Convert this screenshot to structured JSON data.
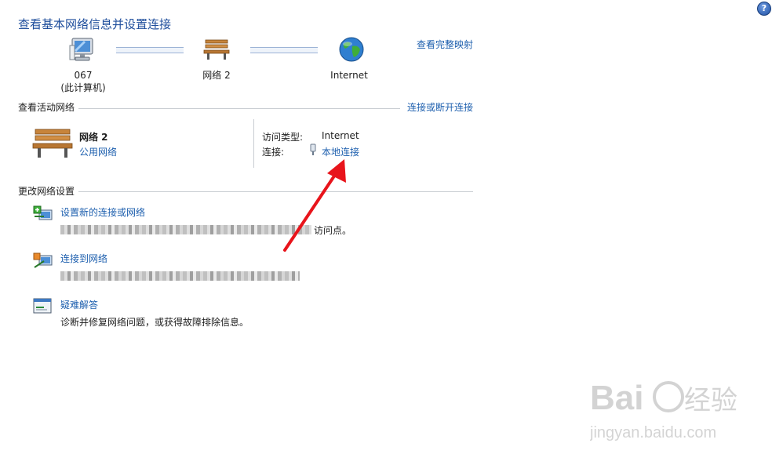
{
  "header": {
    "title": "查看基本网络信息并设置连接",
    "view_full_map_link": "查看完整映射"
  },
  "network_map": {
    "computer": {
      "name": "067",
      "subtitle": "(此计算机)",
      "icon": "computer-icon"
    },
    "network": {
      "name": "网络  2",
      "icon": "bench-icon"
    },
    "internet": {
      "name": "Internet",
      "icon": "globe-icon"
    }
  },
  "active_networks": {
    "heading": "查看活动网络",
    "connect_link": "连接或断开连接",
    "network_name": "网络  2",
    "network_type": "公用网络",
    "access_type_label": "访问类型:",
    "access_type_value": "Internet",
    "connections_label": "连接:",
    "connection_link": "本地连接"
  },
  "change_settings": {
    "heading": "更改网络设置",
    "items": [
      {
        "title": "设置新的连接或网络",
        "desc_suffix": "访问点。",
        "icon": "new-connection-icon"
      },
      {
        "title": "连接到网络",
        "desc_suffix": "",
        "icon": "connect-network-icon"
      },
      {
        "title": "疑难解答",
        "desc": "诊断并修复网络问题，或获得故障排除信息。",
        "icon": "troubleshoot-icon"
      }
    ]
  },
  "watermark": {
    "brand": "Bai du 经验",
    "url": "jingyan.baidu.com"
  },
  "colors": {
    "link": "#1d5fae",
    "title": "#1f4e9c",
    "arrow": "#e8141b"
  }
}
